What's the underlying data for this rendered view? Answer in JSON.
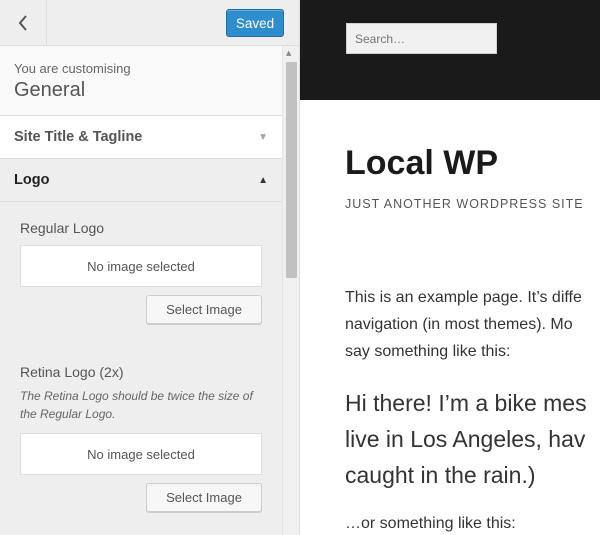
{
  "header": {
    "saved_label": "Saved"
  },
  "panel": {
    "customising_label": "You are customising",
    "customising_title": "General",
    "sections": [
      {
        "label": "Site Title & Tagline",
        "state": "collapsed"
      },
      {
        "label": "Logo",
        "state": "expanded"
      }
    ],
    "logo": {
      "regular": {
        "title": "Regular Logo",
        "placeholder": "No image selected",
        "button": "Select Image"
      },
      "retina": {
        "title": "Retina Logo (2x)",
        "description": "The Retina Logo should be twice the size of the Regular Logo.",
        "placeholder": "No image selected",
        "button": "Select Image"
      }
    }
  },
  "preview": {
    "search_placeholder": "Search…",
    "site_title": "Local WP",
    "tagline": "JUST ANOTHER WORDPRESS SITE",
    "paragraph_lines": [
      "This is an example page. It’s diffe",
      "navigation (in most themes). Mo",
      "say something like this:"
    ],
    "quote_lines": [
      "Hi there! I’m a bike mes",
      "live in Los Angeles, hav",
      "caught in the rain.)"
    ],
    "paragraph2": "…or something like this:"
  },
  "colors": {
    "accent": "#2e8ecd",
    "header_bg": "#1a1a1a",
    "panel_bg": "#eeeeee"
  }
}
